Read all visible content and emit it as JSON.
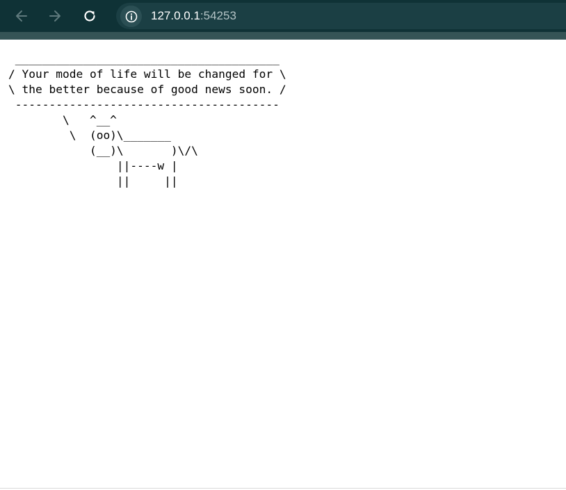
{
  "browser": {
    "url_host": "127.0.0.1",
    "url_port": ":54253",
    "icons": {
      "back": "arrow-left-icon",
      "forward": "arrow-right-icon",
      "reload": "reload-icon",
      "site_info": "info-icon"
    },
    "colors": {
      "toolbar": "#0f3236",
      "omnibox": "#1b3f44"
    }
  },
  "page": {
    "cowsay_text": " _______________________________________\n/ Your mode of life will be changed for \\\n\\ the better because of good news soon. /\n ---------------------------------------\n        \\   ^__^\n         \\  (oo)\\_______\n            (__)\\       )\\/\\\n                ||----w |\n                ||     ||"
  }
}
